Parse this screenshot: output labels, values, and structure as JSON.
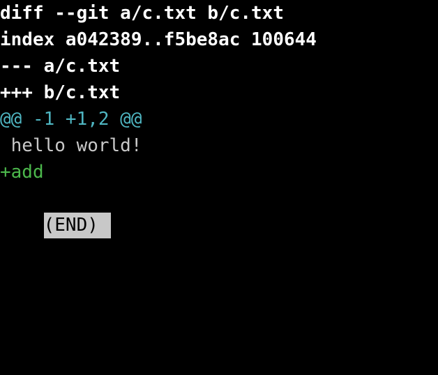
{
  "terminal": {
    "lines": {
      "diff_header": "diff --git a/c.txt b/c.txt",
      "index_line": "index a042389..f5be8ac 100644",
      "old_file": "--- a/c.txt",
      "new_file": "+++ b/c.txt",
      "hunk_header": "@@ -1 +1,2 @@",
      "context_line": " hello world!",
      "added_line": "+add"
    },
    "pager_status": "(END)"
  },
  "colors": {
    "background": "#000000",
    "header_text": "#ffffff",
    "hunk_header": "#4fb6c2",
    "context_text": "#c8c8c8",
    "added_text": "#4cb84c",
    "pager_highlight": "#c8c8c8"
  }
}
